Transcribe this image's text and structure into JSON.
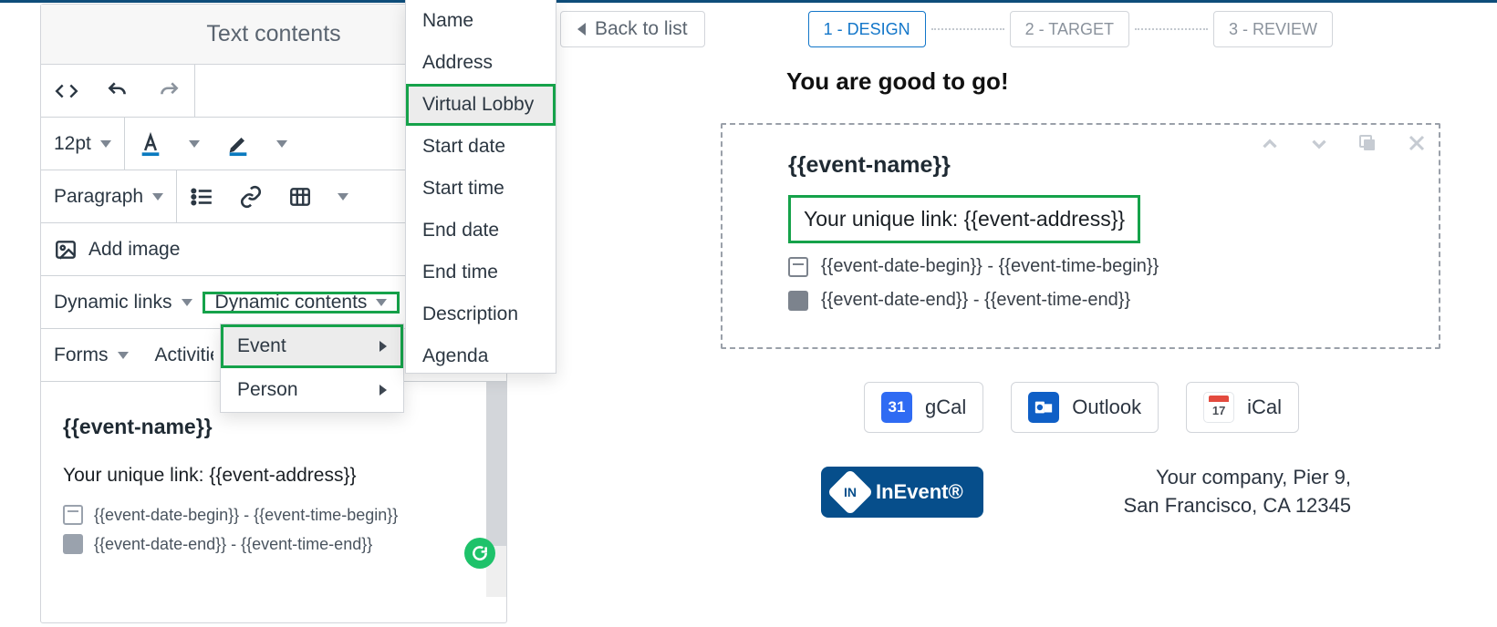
{
  "panel": {
    "title": "Text contents",
    "font_size": "12pt",
    "para": "Paragraph",
    "add_image": "Add image",
    "dynamic_links": "Dynamic links",
    "dynamic_contents": "Dynamic contents",
    "forms": "Forms",
    "activities": "Activities"
  },
  "menu1": {
    "event": "Event",
    "person": "Person"
  },
  "menu2": {
    "name": "Name",
    "address": "Address",
    "virtual_lobby": "Virtual Lobby",
    "start_date": "Start date",
    "start_time": "Start time",
    "end_date": "End date",
    "end_time": "End time",
    "description": "Description",
    "agenda": "Agenda"
  },
  "editor_preview": {
    "h": "{{event-name}}",
    "link": "Your unique link: {{event-address}}",
    "r1": "{{event-date-begin}} - {{event-time-begin}}",
    "r2": "{{event-date-end}} - {{event-time-end}}"
  },
  "back": "Back to list",
  "steps": {
    "s1": "1 - DESIGN",
    "s2": "2 - TARGET",
    "s3": "3 - REVIEW"
  },
  "preview": {
    "heading": "You are good to go!",
    "h": "{{event-name}}",
    "link": "Your unique link: {{event-address}}",
    "r1": "{{event-date-begin}} - {{event-time-begin}}",
    "r2": "{{event-date-end}} - {{event-time-end}}"
  },
  "cal": {
    "gcal": "gCal",
    "outlook": "Outlook",
    "ical": "iCal",
    "gday": "31"
  },
  "footer": {
    "brand": "InEvent®",
    "addr1": "Your company, Pier 9,",
    "addr2": "San Francisco, CA 12345"
  }
}
